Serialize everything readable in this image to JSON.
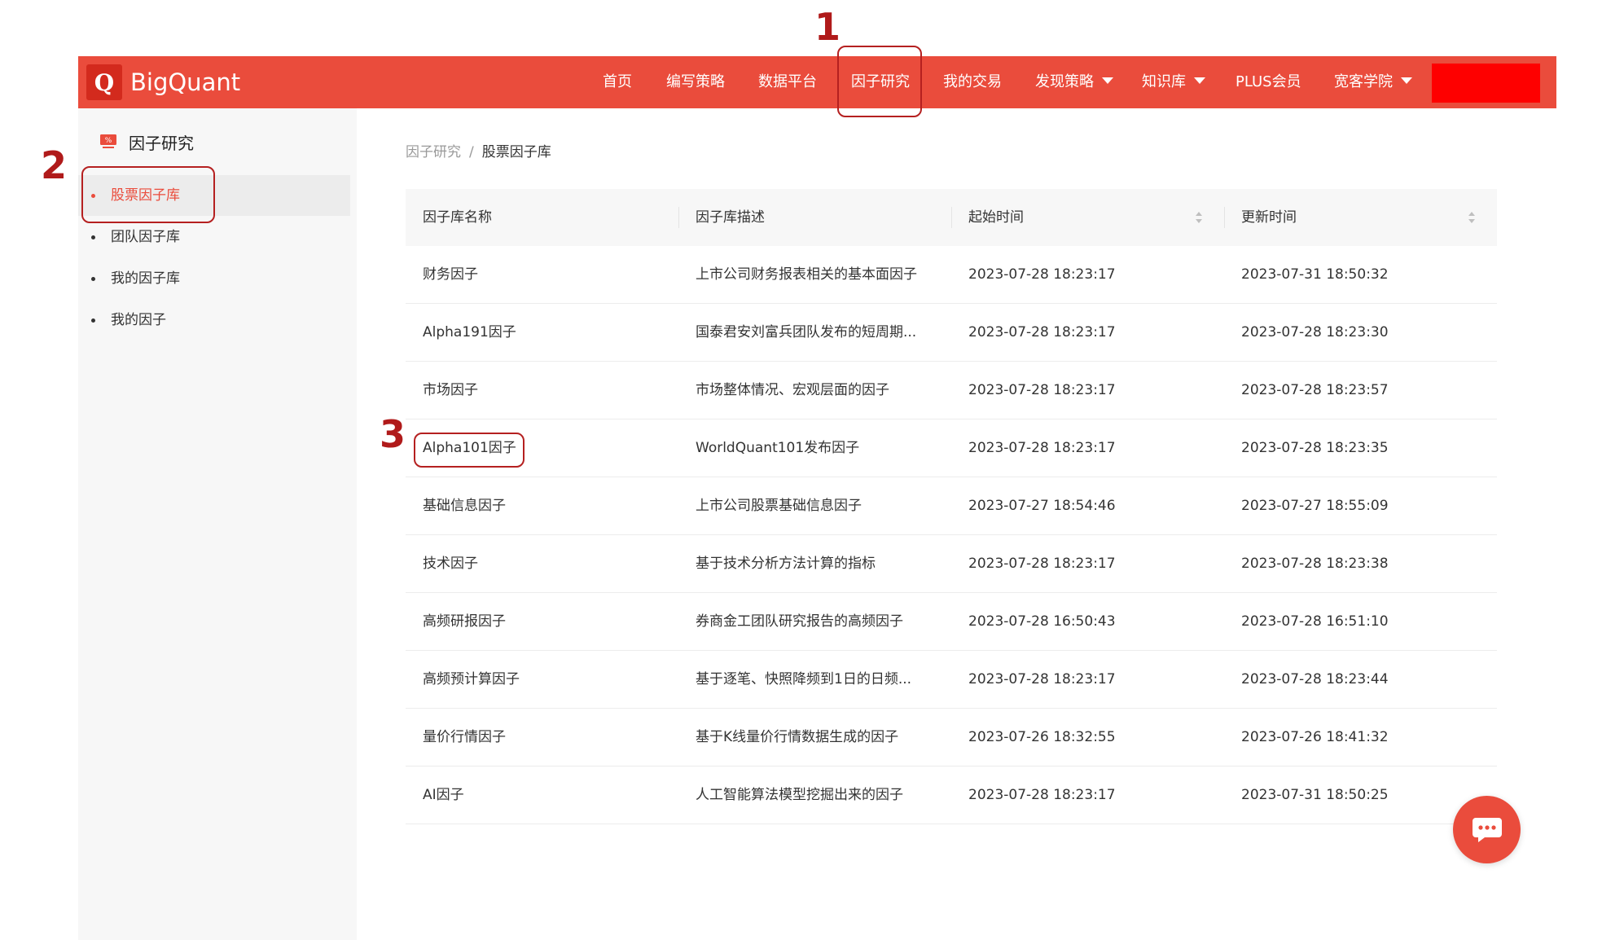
{
  "brand": {
    "logo_letter": "Q",
    "name": "BigQuant",
    "color": "#ea4c3c"
  },
  "nav": {
    "items": [
      {
        "label": "首页",
        "dropdown": false
      },
      {
        "label": "编写策略",
        "dropdown": false
      },
      {
        "label": "数据平台",
        "dropdown": false
      },
      {
        "label": "因子研究",
        "dropdown": false
      },
      {
        "label": "我的交易",
        "dropdown": false
      },
      {
        "label": "发现策略",
        "dropdown": true
      },
      {
        "label": "知识库",
        "dropdown": true
      },
      {
        "label": "PLUS会员",
        "dropdown": false
      },
      {
        "label": "宽客学院",
        "dropdown": true
      }
    ]
  },
  "sidebar": {
    "title": "因子研究",
    "icon": "factor-chart-icon",
    "items": [
      {
        "label": "股票因子库",
        "active": true
      },
      {
        "label": "团队因子库",
        "active": false
      },
      {
        "label": "我的因子库",
        "active": false
      },
      {
        "label": "我的因子",
        "active": false
      }
    ]
  },
  "breadcrumb": {
    "parent": "因子研究",
    "separator": "/",
    "current": "股票因子库"
  },
  "table": {
    "columns": [
      {
        "label": "因子库名称",
        "sortable": false
      },
      {
        "label": "因子库描述",
        "sortable": false
      },
      {
        "label": "起始时间",
        "sortable": true
      },
      {
        "label": "更新时间",
        "sortable": true
      }
    ],
    "rows": [
      {
        "name": "财务因子",
        "desc": "上市公司财务报表相关的基本面因子",
        "start": "2023-07-28 18:23:17",
        "update": "2023-07-31 18:50:32"
      },
      {
        "name": "Alpha191因子",
        "desc": "国泰君安刘富兵团队发布的短周期...",
        "start": "2023-07-28 18:23:17",
        "update": "2023-07-28 18:23:30"
      },
      {
        "name": "市场因子",
        "desc": "市场整体情况、宏观层面的因子",
        "start": "2023-07-28 18:23:17",
        "update": "2023-07-28 18:23:57"
      },
      {
        "name": "Alpha101因子",
        "desc": "WorldQuant101发布因子",
        "start": "2023-07-28 18:23:17",
        "update": "2023-07-28 18:23:35"
      },
      {
        "name": "基础信息因子",
        "desc": "上市公司股票基础信息因子",
        "start": "2023-07-27 18:54:46",
        "update": "2023-07-27 18:55:09"
      },
      {
        "name": "技术因子",
        "desc": "基于技术分析方法计算的指标",
        "start": "2023-07-28 18:23:17",
        "update": "2023-07-28 18:23:38"
      },
      {
        "name": "高频研报因子",
        "desc": "券商金工团队研究报告的高频因子",
        "start": "2023-07-28 16:50:43",
        "update": "2023-07-28 16:51:10"
      },
      {
        "name": "高频预计算因子",
        "desc": "基于逐笔、快照降频到1日的日频...",
        "start": "2023-07-28 18:23:17",
        "update": "2023-07-28 18:23:44"
      },
      {
        "name": "量价行情因子",
        "desc": "基于K线量价行情数据生成的因子",
        "start": "2023-07-26 18:32:55",
        "update": "2023-07-26 18:41:32"
      },
      {
        "name": "AI因子",
        "desc": "人工智能算法模型挖掘出来的因子",
        "start": "2023-07-28 18:23:17",
        "update": "2023-07-31 18:50:25"
      }
    ]
  },
  "annotations": [
    {
      "number": "1",
      "target": "因子研究"
    },
    {
      "number": "2",
      "target": "股票因子库"
    },
    {
      "number": "3",
      "target": "Alpha101因子"
    }
  ],
  "chat": {
    "icon": "chat-bubble-icon"
  },
  "colors": {
    "accent": "#ea4c3c",
    "annotation": "#b52020",
    "user_block": "#fe0000"
  }
}
